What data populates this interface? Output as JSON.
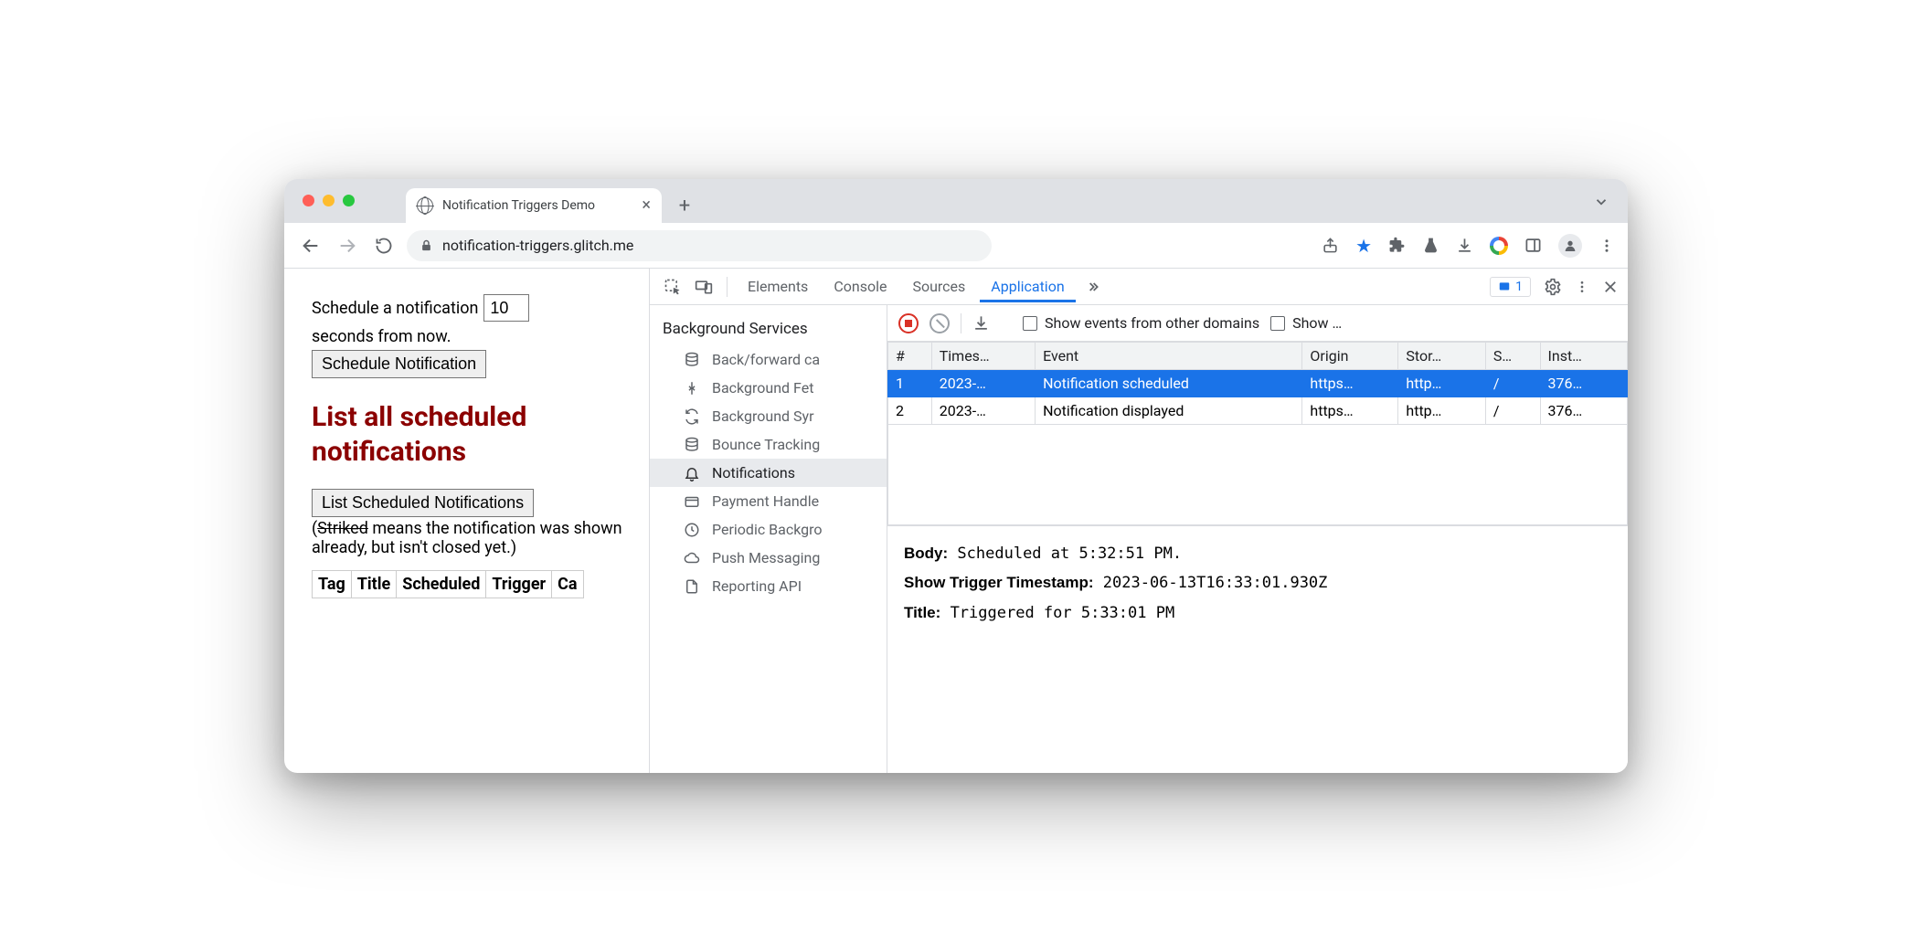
{
  "browser": {
    "tab_title": "Notification Triggers Demo",
    "url": "notification-triggers.glitch.me"
  },
  "page": {
    "schedule_prefix": "Schedule a notification",
    "schedule_value": "10",
    "schedule_suffix": "seconds from now.",
    "schedule_button": "Schedule Notification",
    "heading": "List all scheduled notifications",
    "list_button": "List Scheduled Notifications",
    "note_open": "(",
    "note_striked": "Striked",
    "note_rest": " means the notification was shown already, but isn't closed yet.)",
    "cols": {
      "c1": "Tag",
      "c2": "Title",
      "c3": "Scheduled",
      "c4": "Trigger",
      "c5": "Ca"
    }
  },
  "devtools": {
    "tabs": {
      "elements": "Elements",
      "console": "Console",
      "sources": "Sources",
      "application": "Application"
    },
    "issues_count": "1",
    "sidebar": {
      "group": "Background Services",
      "items": {
        "bf": "Back/forward ca",
        "bgfetch": "Background Fet",
        "bgsync": "Background Syr",
        "bounce": "Bounce Tracking",
        "notif": "Notifications",
        "payment": "Payment Handle",
        "periodic": "Periodic Backgro",
        "push": "Push Messaging",
        "report": "Reporting API"
      }
    },
    "events": {
      "toolbar": {
        "chk1": "Show events from other domains",
        "chk2": "Show …"
      },
      "headers": {
        "n": "#",
        "ts": "Times…",
        "ev": "Event",
        "or": "Origin",
        "st": "Stor…",
        "s": "S…",
        "inst": "Inst…"
      },
      "rows": [
        {
          "n": "1",
          "ts": "2023-…",
          "ev": "Notification scheduled",
          "or": "https…",
          "st": "http…",
          "s": "/",
          "inst": "376…"
        },
        {
          "n": "2",
          "ts": "2023-…",
          "ev": "Notification displayed",
          "or": "https…",
          "st": "http…",
          "s": "/",
          "inst": "376…"
        }
      ],
      "detail": {
        "body_label": "Body:",
        "body_value": "Scheduled at 5:32:51 PM.",
        "trigger_label": "Show Trigger Timestamp:",
        "trigger_value": "2023-06-13T16:33:01.930Z",
        "title_label": "Title:",
        "title_value": "Triggered for 5:33:01 PM"
      }
    }
  }
}
